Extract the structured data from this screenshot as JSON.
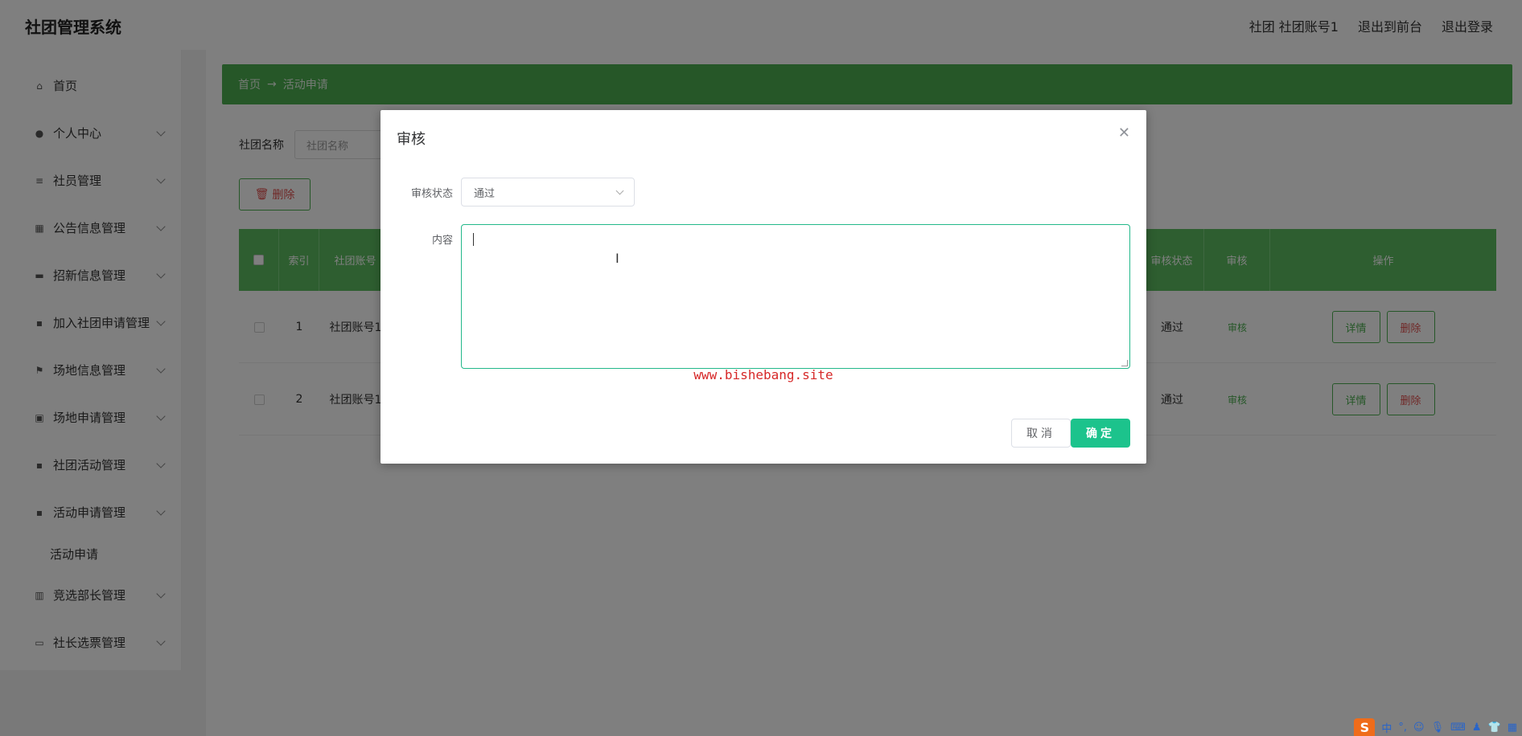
{
  "header": {
    "app_title": "社团管理系统",
    "user_label": "社团 社团账号1",
    "goto_front": "退出到前台",
    "logout": "退出登录"
  },
  "sidebar": {
    "items": [
      {
        "label": "首页",
        "icon": "home-icon"
      },
      {
        "label": "个人中心",
        "icon": "user-icon"
      },
      {
        "label": "社员管理",
        "icon": "list-icon"
      },
      {
        "label": "公告信息管理",
        "icon": "grid-icon"
      },
      {
        "label": "招新信息管理",
        "icon": "briefcase-icon"
      },
      {
        "label": "加入社团申请管理",
        "icon": "apps-icon"
      },
      {
        "label": "场地信息管理",
        "icon": "flag-icon"
      },
      {
        "label": "场地申请管理",
        "icon": "box-icon"
      },
      {
        "label": "社团活动管理",
        "icon": "apps-icon"
      },
      {
        "label": "活动申请管理",
        "icon": "apps-icon"
      },
      {
        "label": "竞选部长管理",
        "icon": "chart-icon"
      },
      {
        "label": "社长选票管理",
        "icon": "monitor-icon"
      }
    ],
    "sub_item": "活动申请"
  },
  "breadcrumb": {
    "home": "首页",
    "arrow": "→",
    "current": "活动申请"
  },
  "search": {
    "label": "社团名称",
    "placeholder": "社团名称"
  },
  "toolbar": {
    "delete_label": "删除"
  },
  "table": {
    "headers": [
      "索引",
      "社团账号",
      "审核状态",
      "审核",
      "操作"
    ],
    "rows": [
      {
        "index": "1",
        "account": "社团账号1",
        "status": "通过",
        "audit": "审核",
        "detail": "详情",
        "delete": "删除"
      },
      {
        "index": "2",
        "account": "社团账号1",
        "status": "通过",
        "audit": "审核",
        "detail": "详情",
        "delete": "删除"
      }
    ]
  },
  "dialog": {
    "title": "审核",
    "status_label": "审核状态",
    "status_value": "通过",
    "content_label": "内容",
    "content_value": "",
    "watermark": "www.bishebang.site",
    "cancel": "取消",
    "ok": "确定"
  },
  "tray": {
    "ime_logo": "S",
    "ime_mode": "中"
  },
  "colors": {
    "accent": "#4caf50",
    "primary_button": "#1cc38c",
    "danger": "#e0504f",
    "watermark": "#d62828"
  }
}
